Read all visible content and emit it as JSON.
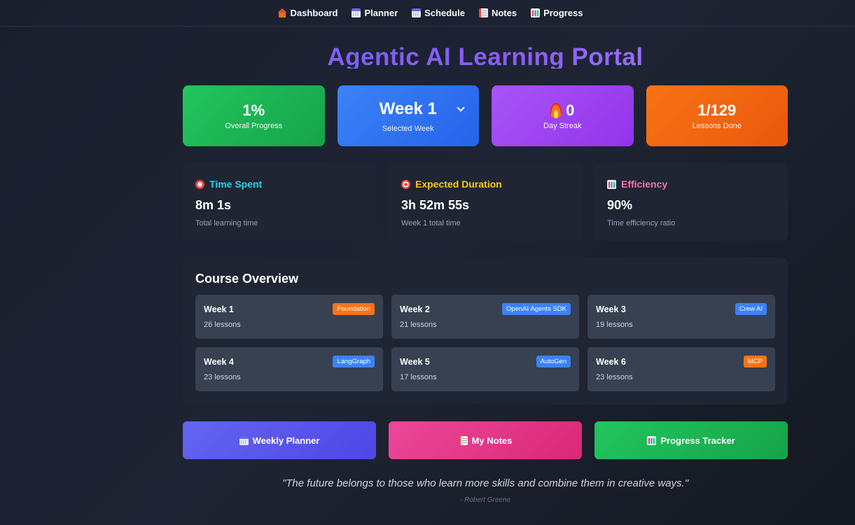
{
  "nav": {
    "items": [
      {
        "label": "Dashboard",
        "icon": "home-icon"
      },
      {
        "label": "Planner",
        "icon": "calendar-icon"
      },
      {
        "label": "Schedule",
        "icon": "calendar-icon"
      },
      {
        "label": "Notes",
        "icon": "notepad-icon"
      },
      {
        "label": "Progress",
        "icon": "bar-chart-icon"
      }
    ]
  },
  "page": {
    "title": "Agentic AI Learning Portal"
  },
  "stats": {
    "progress": {
      "value": "1%",
      "label": "Overall Progress"
    },
    "week": {
      "value": "Week 1",
      "label": "Selected Week"
    },
    "streak": {
      "value": "0",
      "label": "Day Streak",
      "icon": "fire-icon"
    },
    "lessons": {
      "value": "1/129",
      "label": "Lessons Done"
    }
  },
  "metrics": {
    "time_spent": {
      "title": "Time Spent",
      "value": "8m 1s",
      "sub": "Total learning time",
      "icon": "alarm-clock-icon",
      "color": "#22d3ee"
    },
    "expected": {
      "title": "Expected Duration",
      "value": "3h 52m 55s",
      "sub": "Week 1 total time",
      "icon": "target-icon",
      "color": "#facc15"
    },
    "efficiency": {
      "title": "Efficiency",
      "value": "90%",
      "sub": "Time efficiency ratio",
      "icon": "bar-chart-icon",
      "color": "#f472b6"
    }
  },
  "overview": {
    "title": "Course Overview",
    "weeks": [
      {
        "name": "Week 1",
        "lessons": "26 lessons",
        "tag": "Foundation",
        "tag_color": "#f97316"
      },
      {
        "name": "Week 2",
        "lessons": "21 lessons",
        "tag": "OpenAI Agents SDK",
        "tag_color": "#3b82f6"
      },
      {
        "name": "Week 3",
        "lessons": "19 lessons",
        "tag": "Crew AI",
        "tag_color": "#3b82f6"
      },
      {
        "name": "Week 4",
        "lessons": "23 lessons",
        "tag": "LangGraph",
        "tag_color": "#3b82f6"
      },
      {
        "name": "Week 5",
        "lessons": "17 lessons",
        "tag": "AutoGen",
        "tag_color": "#3b82f6"
      },
      {
        "name": "Week 6",
        "lessons": "23 lessons",
        "tag": "MCP",
        "tag_color": "#f97316"
      }
    ]
  },
  "buttons": {
    "planner": "Weekly Planner",
    "notes": "My Notes",
    "progress": "Progress Tracker"
  },
  "quote": {
    "text": "\"The future belongs to those who learn more skills and combine them in creative ways.\"",
    "author": "- Robert Greene"
  }
}
